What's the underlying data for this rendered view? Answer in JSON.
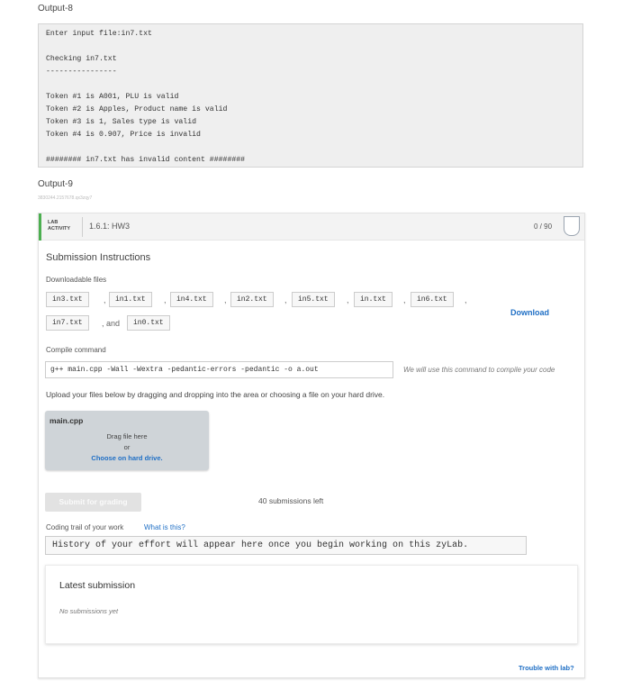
{
  "output8": {
    "label": "Output-8",
    "console": "Enter input file:in7.txt\n\nChecking in7.txt\n----------------\n\nToken #1 is A001, PLU is valid\nToken #2 is Apples, Product name is valid\nToken #3 is 1, Sales type is valid\nToken #4 is 0.907, Price is invalid\n\n######## in7.txt has invalid content ########"
  },
  "output9": {
    "label": "Output-9",
    "tiny_id": "3830244.2157678.qx3zqy7"
  },
  "lab": {
    "tag": "LAB\nACTIVITY",
    "title": "1.6.1: HW3",
    "score": "0 / 90",
    "accent_color": "#4caf50"
  },
  "submission": {
    "title": "Submission Instructions",
    "downloadable_label": "Downloadable files",
    "files_row1": [
      "in3.txt",
      "in1.txt",
      "in4.txt",
      "in2.txt",
      "in5.txt",
      "in.txt",
      "in6.txt"
    ],
    "files_row2": [
      "in7.txt",
      "in0.txt"
    ],
    "comma": ",",
    "and_text": ", and",
    "download_label": "Download",
    "compile_label": "Compile command",
    "compile_command": "g++ main.cpp -Wall -Wextra -pedantic-errors -pedantic -o a.out",
    "compile_note": "We will use this command to compile your code",
    "upload_text": "Upload your files below by dragging and dropping into the area or choosing a file on your hard drive.",
    "drop": {
      "file_name": "main.cpp",
      "drag_text": "Drag file here",
      "or_text": "or",
      "choose_text": "Choose on hard drive."
    },
    "submit_label": "Submit for grading",
    "submissions_left": "40 submissions left",
    "trail_label": "Coding trail of your work",
    "what_link": "What is this?",
    "history_text": "History of your effort will appear here once you begin working on this zyLab.",
    "latest_title": "Latest submission",
    "latest_none": "No submissions yet",
    "trouble_link": "Trouble with lab?"
  },
  "colors": {
    "link": "#1f6fc5",
    "drop_bg": "#cfd4d8"
  }
}
